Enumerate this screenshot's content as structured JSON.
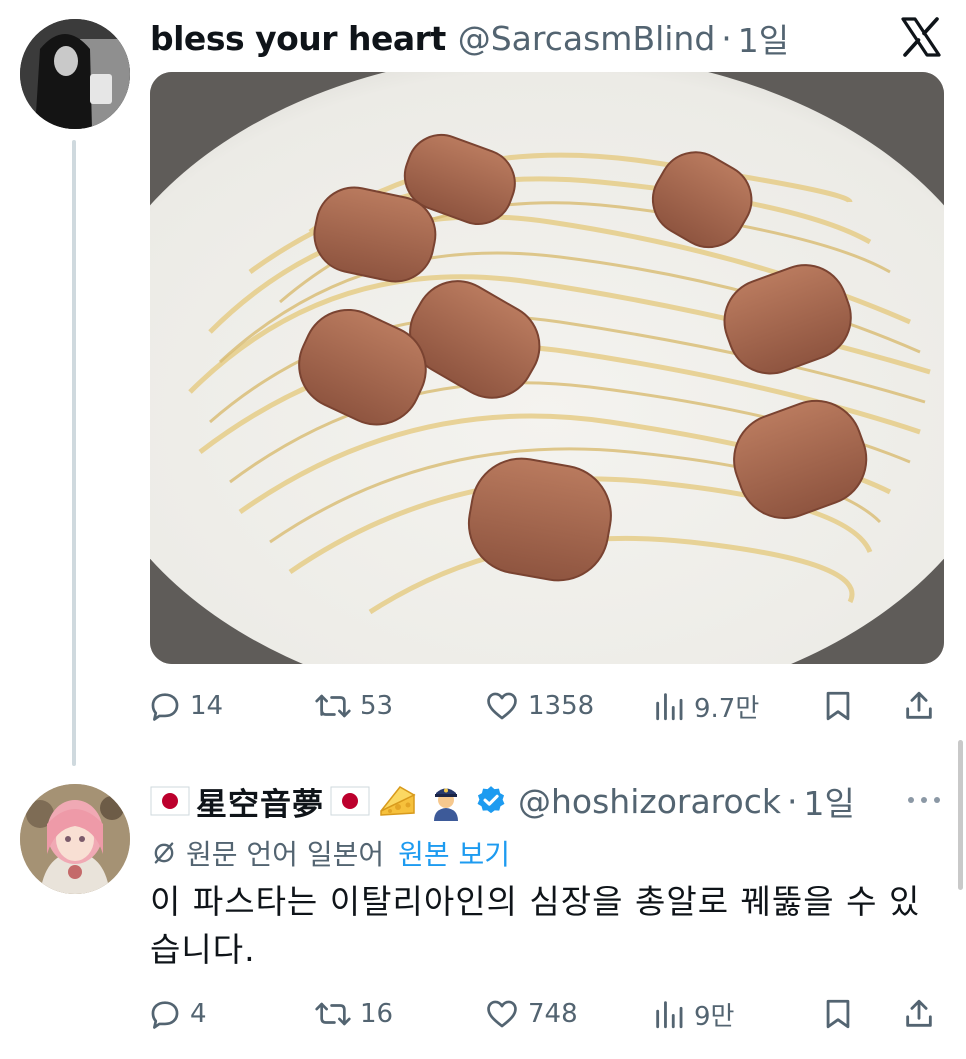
{
  "tweet1": {
    "display_name": "bless your heart",
    "handle": "@SarcasmBlind",
    "separator": "·",
    "time": "1일",
    "actions": {
      "replies": "14",
      "retweets": "53",
      "likes": "1358",
      "views": "9.7만"
    }
  },
  "tweet2": {
    "display_name": "星空音夢",
    "handle": "@hoshizorarock",
    "separator": "·",
    "time": "1일",
    "original_language": "원문 언어 일본어",
    "show_original": "원본 보기",
    "text": "이 파스타는 이탈리아인의 심장을 총알로 꿰뚫을 수 있습니다.",
    "actions": {
      "replies": "4",
      "retweets": "16",
      "likes": "748",
      "views": "9만"
    }
  },
  "icons": {
    "brand": "x-logo-icon",
    "reply": "speech-bubble-icon",
    "retweet": "retweet-arrows-icon",
    "like": "heart-icon",
    "views": "bar-chart-icon",
    "bookmark": "bookmark-icon",
    "share": "share-upload-icon",
    "more": "ellipsis-icon",
    "verified": "verified-badge-icon",
    "translate": "slashed-circle-icon"
  },
  "colors": {
    "text": "#0f1419",
    "secondary": "#536471",
    "link": "#1d9bf0",
    "verified": "#1d9bf0"
  }
}
